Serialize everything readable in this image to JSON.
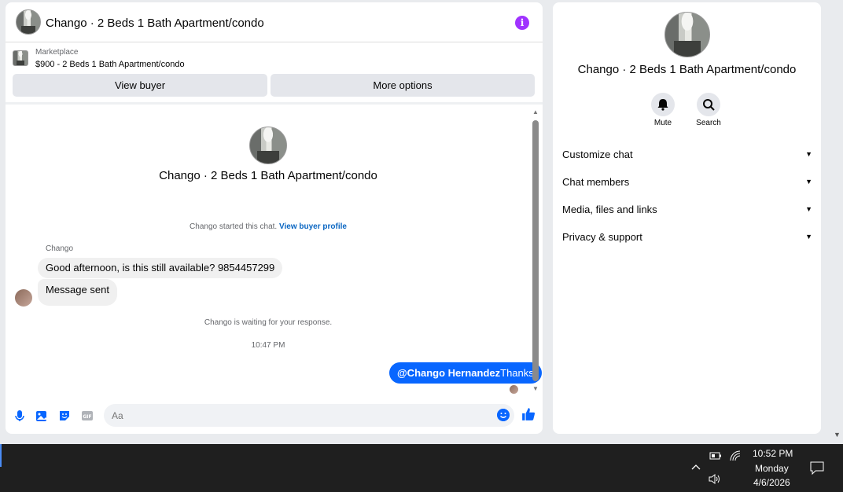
{
  "chat": {
    "title": "Chango · 2 Beds 1 Bath Apartment/condo",
    "info_icon": "info-icon",
    "marketplace": {
      "label": "Marketplace",
      "listing": "$900 - 2 Beds 1 Bath Apartment/condo",
      "view_buyer": "View buyer",
      "more_options": "More options"
    },
    "conversation": {
      "title": "Chango · 2 Beds 1 Bath Apartment/condo",
      "started_text": "Chango started this chat.",
      "started_link": "View buyer profile",
      "sender": "Chango",
      "messages": [
        "Good afternoon, is this still available? 9854457299",
        "Message sent"
      ],
      "waiting": "Chango is waiting for your response.",
      "timestamp": "10:47 PM",
      "outgoing_mention": "@Chango Hernandez",
      "outgoing_text": "Thanks"
    },
    "composer": {
      "placeholder": "Aa",
      "icons": [
        "microphone-icon",
        "image-icon",
        "sticker-icon",
        "gif-icon",
        "emoji-icon",
        "thumbs-up-icon"
      ]
    }
  },
  "info_panel": {
    "title": "Chango · 2 Beds 1 Bath Apartment/condo",
    "mute_label": "Mute",
    "search_label": "Search",
    "sections": [
      "Customize chat",
      "Chat members",
      "Media, files and links",
      "Privacy & support"
    ]
  },
  "taskbar": {
    "time": "10:52 PM",
    "day": "Monday",
    "date": "4/6/2026"
  }
}
